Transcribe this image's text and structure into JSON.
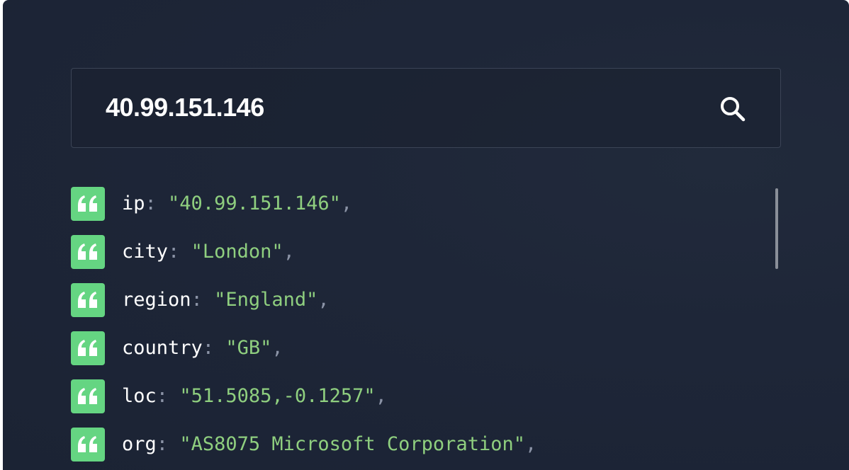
{
  "search": {
    "value": "40.99.151.146",
    "icon": "search-icon"
  },
  "colors": {
    "panel_bg": "#1e2638",
    "badge": "#65d582",
    "key": "#ffffff",
    "string_value": "#8fcf7f",
    "punctuation": "#8b93a6"
  },
  "result": {
    "rows": [
      {
        "key": "ip",
        "colon": ":",
        "value": "\"40.99.151.146\"",
        "comma": ","
      },
      {
        "key": "city",
        "colon": ":",
        "value": "\"London\"",
        "comma": ","
      },
      {
        "key": "region",
        "colon": ":",
        "value": "\"England\"",
        "comma": ","
      },
      {
        "key": "country",
        "colon": ":",
        "value": "\"GB\"",
        "comma": ","
      },
      {
        "key": "loc",
        "colon": ":",
        "value": "\"51.5085,-0.1257\"",
        "comma": ","
      },
      {
        "key": "org",
        "colon": ":",
        "value": "\"AS8075 Microsoft Corporation\"",
        "comma": ","
      }
    ]
  }
}
